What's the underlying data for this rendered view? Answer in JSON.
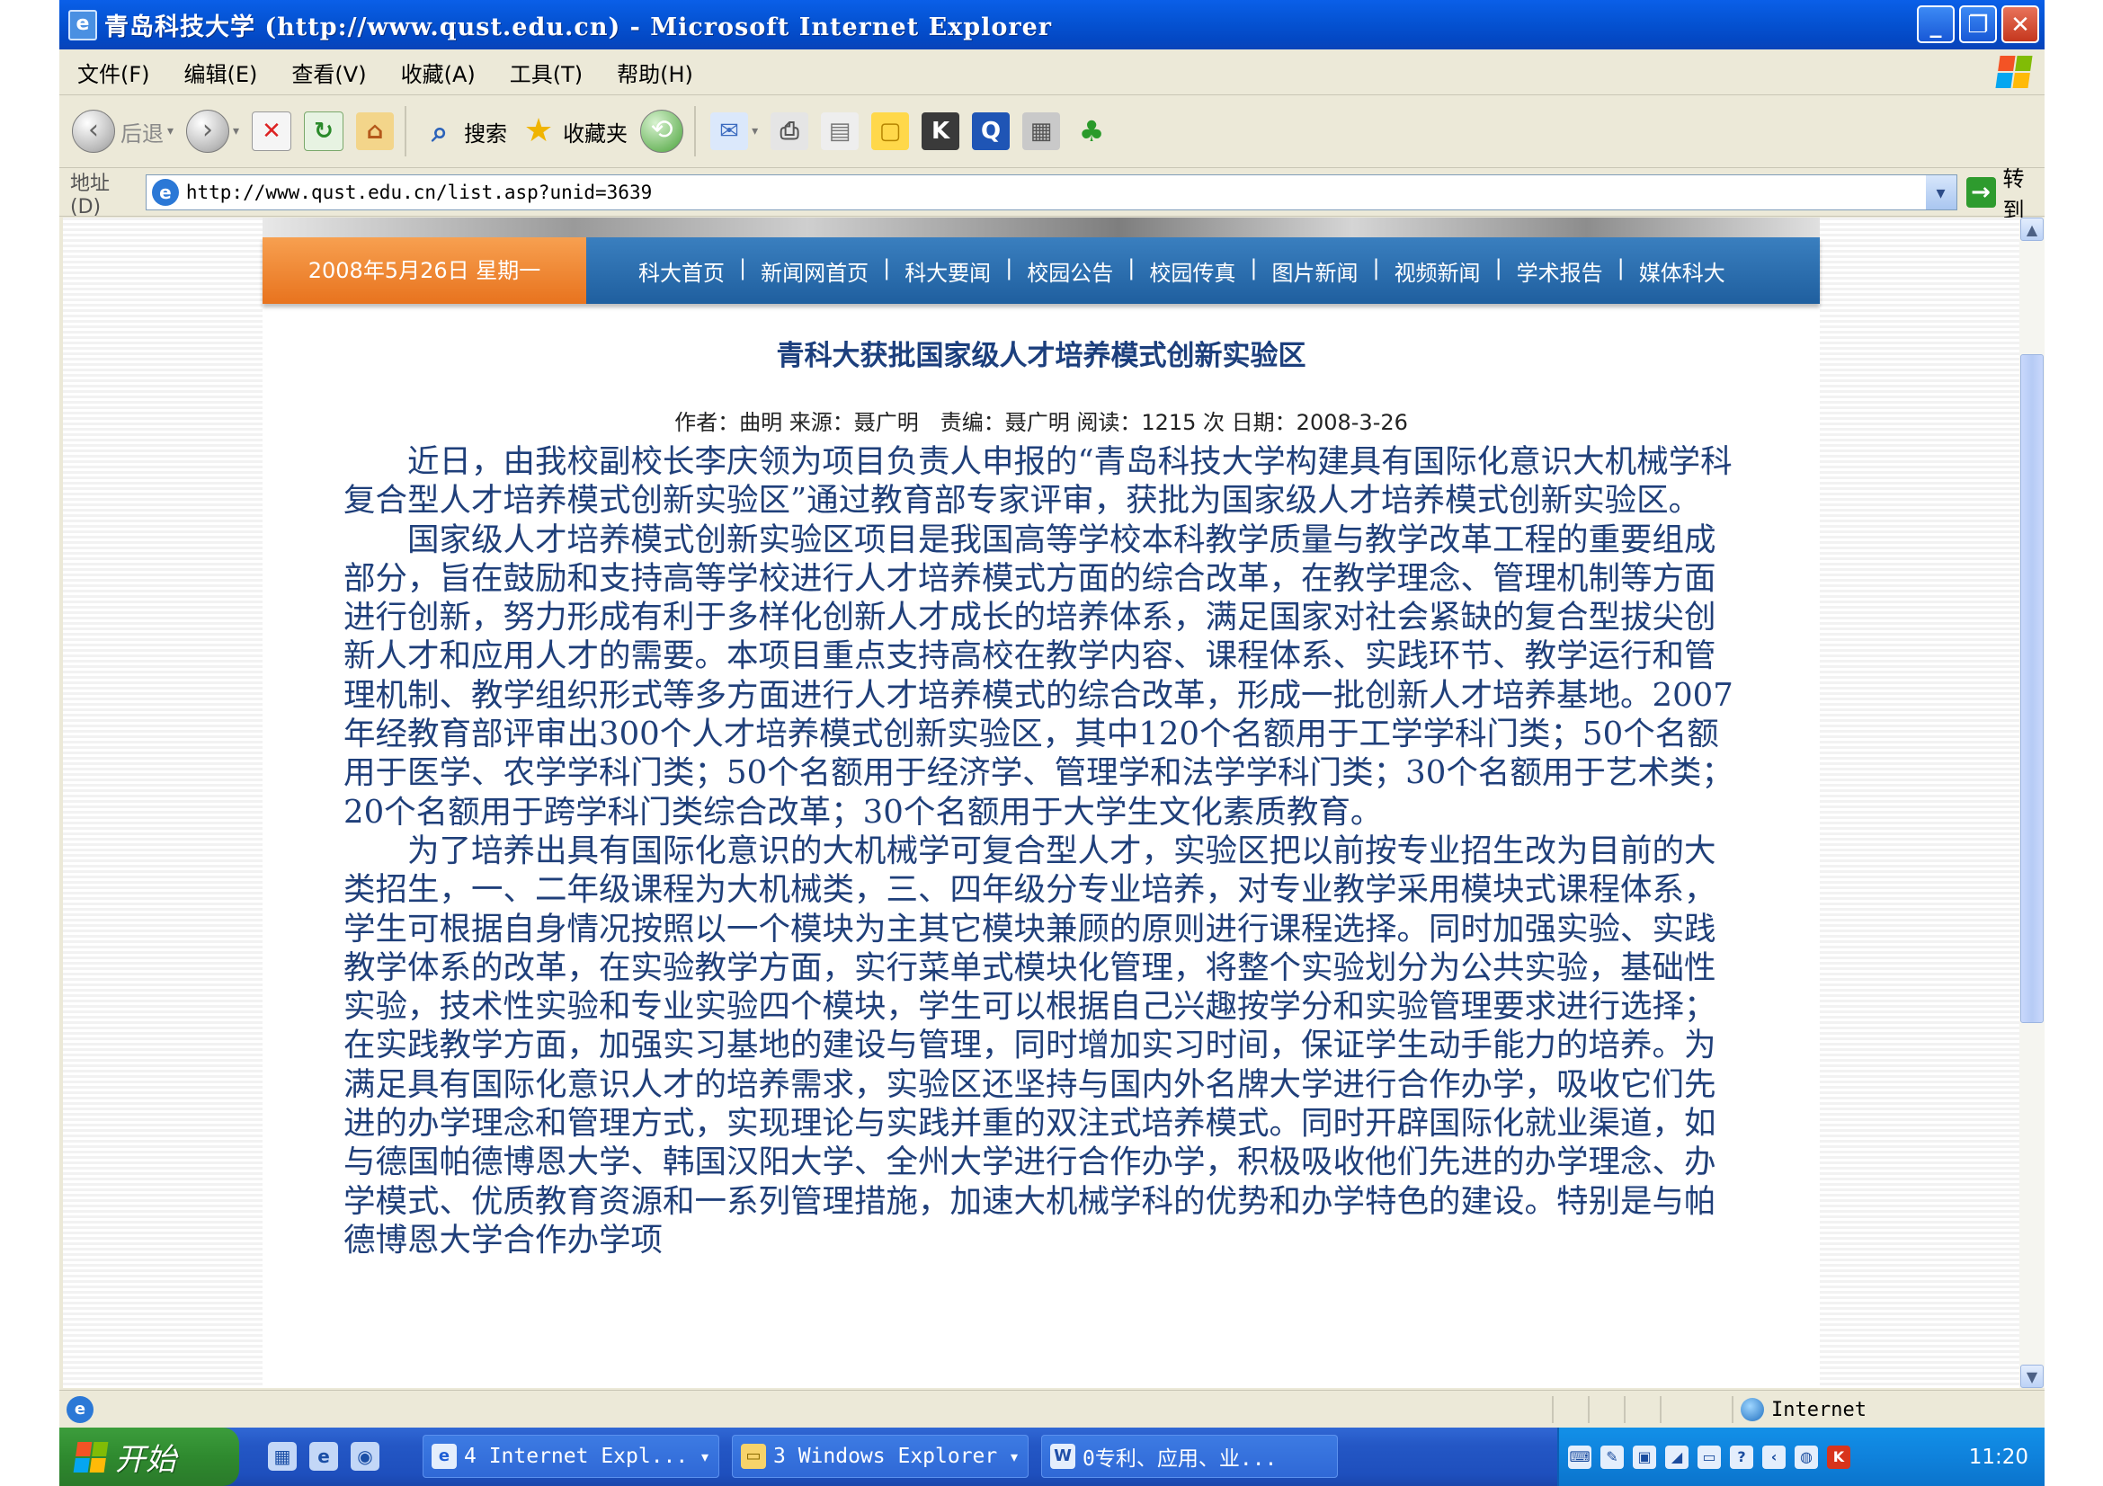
{
  "window": {
    "title": "青岛科技大学 (http://www.qust.edu.cn) - Microsoft Internet Explorer",
    "controls": {
      "minimize": "_",
      "restore": "❐",
      "close": "✕"
    }
  },
  "menu": [
    "文件(F)",
    "编辑(E)",
    "查看(V)",
    "收藏(A)",
    "工具(T)",
    "帮助(H)"
  ],
  "toolbar": {
    "back_label": "后退",
    "search_label": "搜索",
    "favorites_label": "收藏夹"
  },
  "address": {
    "label": "地址(D)",
    "url": "http://www.qust.edu.cn/list.asp?unid=3639",
    "go_label": "转到"
  },
  "site": {
    "date": "2008年5月26日 星期一",
    "nav": [
      "科大首页",
      "新闻网首页",
      "科大要闻",
      "校园公告",
      "校园传真",
      "图片新闻",
      "视频新闻",
      "学术报告",
      "媒体科大"
    ]
  },
  "article": {
    "title": "青科大获批国家级人才培养模式创新实验区",
    "meta": "作者：曲明 来源：聂广明　责编：聂广明 阅读：1215 次 日期：2008-3-26",
    "paragraphs": [
      "近日，由我校副校长李庆领为项目负责人申报的“青岛科技大学构建具有国际化意识大机械学科复合型人才培养模式创新实验区”通过教育部专家评审，获批为国家级人才培养模式创新实验区。",
      "国家级人才培养模式创新实验区项目是我国高等学校本科教学质量与教学改革工程的重要组成部分，旨在鼓励和支持高等学校进行人才培养模式方面的综合改革，在教学理念、管理机制等方面进行创新，努力形成有利于多样化创新人才成长的培养体系，满足国家对社会紧缺的复合型拔尖创新人才和应用人才的需要。本项目重点支持高校在教学内容、课程体系、实践环节、教学运行和管理机制、教学组织形式等多方面进行人才培养模式的综合改革，形成一批创新人才培养基地。2007年经教育部评审出300个人才培养模式创新实验区，其中120个名额用于工学学科门类；50个名额用于医学、农学学科门类；50个名额用于经济学、管理学和法学学科门类；30个名额用于艺术类；20个名额用于跨学科门类综合改革；30个名额用于大学生文化素质教育。",
      "为了培养出具有国际化意识的大机械学可复合型人才，实验区把以前按专业招生改为目前的大类招生，一、二年级课程为大机械类，三、四年级分专业培养，对专业教学采用模块式课程体系，学生可根据自身情况按照以一个模块为主其它模块兼顾的原则进行课程选择。同时加强实验、实践教学体系的改革，在实验教学方面，实行菜单式模块化管理，将整个实验划分为公共实验，基础性实验，技术性实验和专业实验四个模块，学生可以根据自己兴趣按学分和实验管理要求进行选择；在实践教学方面，加强实习基地的建设与管理，同时增加实习时间，保证学生动手能力的培养。为满足具有国际化意识人才的培养需求，实验区还坚持与国内外名牌大学进行合作办学，吸收它们先进的办学理念和管理方式，实现理论与实践并重的双注式培养模式。同时开辟国际化就业渠道，如与德国帕德博恩大学、韩国汉阳大学、全州大学进行合作办学，积极吸收他们先进的办学理念、办学模式、优质教育资源和一系列管理措施，加速大机械学科的优势和办学特色的建设。特别是与帕德博恩大学合作办学项"
    ]
  },
  "statusbar": {
    "zone": "Internet"
  },
  "taskbar": {
    "start_label": "开始",
    "tasks": [
      {
        "label": "4 Internet Expl...",
        "icon": "ie-icon"
      },
      {
        "label": "3 Windows Explorer",
        "icon": "folder-icon"
      },
      {
        "label": "0专利、应用、业...",
        "icon": "word-icon"
      }
    ],
    "clock": "11:20"
  }
}
